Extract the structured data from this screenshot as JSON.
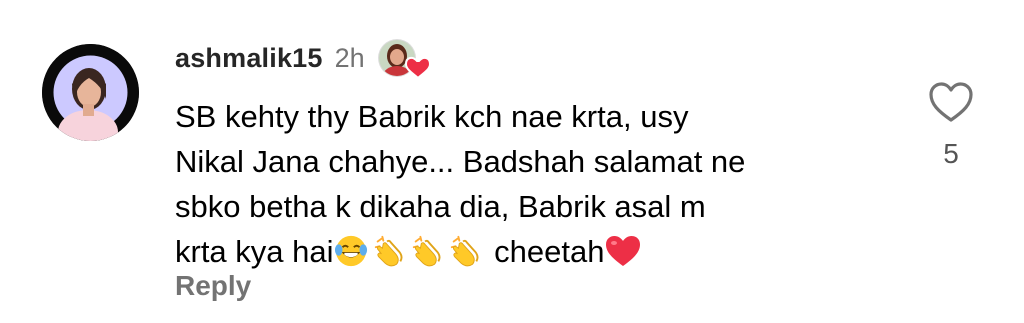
{
  "comment": {
    "username": "ashmalik15",
    "time": "2h",
    "text": {
      "line1": "SB kehty thy Babrik kch nae krta, usy",
      "line2": "Nikal Jana chahye... Badshah salamat ne",
      "line3": "sbko betha k dikaha dia, Babrik asal m",
      "line4_start": "krta kya hai",
      "line4_end": " cheetah"
    },
    "emojis": [
      "laughing-tears-emoji",
      "clapping-hands-emoji",
      "clapping-hands-emoji",
      "clapping-hands-emoji",
      "red-heart-emoji"
    ],
    "reply_label": "Reply",
    "like_count": "5"
  },
  "colors": {
    "username": "#262626",
    "muted": "#737373",
    "heart_red": "#ED2F46",
    "emoji_yellow": "#FFC928"
  },
  "icons": {
    "like": "heart-outline-icon",
    "creator_liked": "creator-liked-avatar-icon"
  }
}
